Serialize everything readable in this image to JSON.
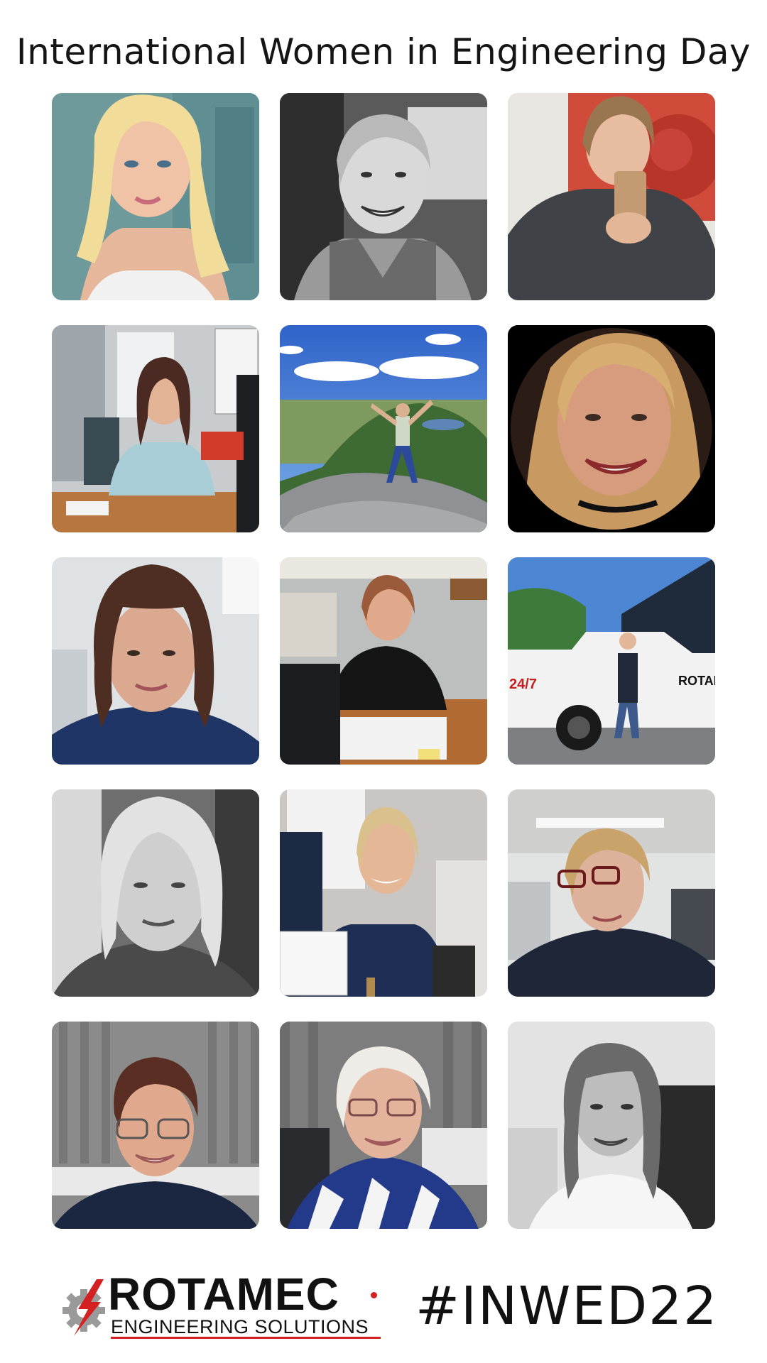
{
  "title": "International Women in Engineering Day",
  "photos": [
    {
      "subject": "woman-blonde-selfie",
      "tone": "color"
    },
    {
      "subject": "woman-smiling-bw",
      "tone": "bw"
    },
    {
      "subject": "woman-mirror-selfie",
      "tone": "color"
    },
    {
      "subject": "woman-at-office-desk",
      "tone": "color"
    },
    {
      "subject": "woman-on-mountain-top",
      "tone": "color"
    },
    {
      "subject": "woman-circle-portrait",
      "tone": "color"
    },
    {
      "subject": "woman-brown-hair-office",
      "tone": "color"
    },
    {
      "subject": "woman-signing-paperwork",
      "tone": "color"
    },
    {
      "subject": "woman-beside-company-van",
      "tone": "color"
    },
    {
      "subject": "woman-portrait-bw",
      "tone": "bw"
    },
    {
      "subject": "woman-holding-certificate",
      "tone": "color"
    },
    {
      "subject": "woman-glasses-office",
      "tone": "color"
    },
    {
      "subject": "woman-short-hair-glasses",
      "tone": "color"
    },
    {
      "subject": "woman-white-hair-glasses",
      "tone": "color"
    },
    {
      "subject": "woman-long-hair-bw",
      "tone": "bw"
    }
  ],
  "footer": {
    "logo_word": "ROTAMEC",
    "logo_sub": "ENGINEERING SOLUTIONS",
    "hashtag": "#INWED22"
  },
  "van_text": {
    "brand": "ROTAMEC",
    "hours": "24/7"
  },
  "colors": {
    "brand_red": "#d32020",
    "text": "#111111"
  }
}
